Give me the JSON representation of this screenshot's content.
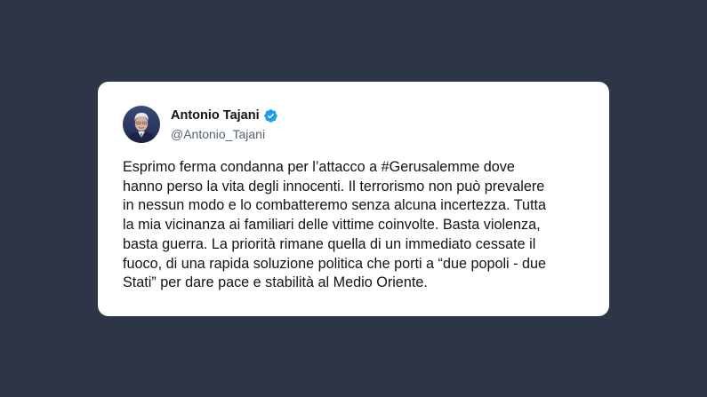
{
  "tweet": {
    "author": {
      "display_name": "Antonio Tajani",
      "handle": "@Antonio_Tajani",
      "verified": true,
      "avatar_icon": "profile-photo"
    },
    "text": "Esprimo ferma condanna per l’attacco a #Gerusalemme dove\nhanno perso la vita degli innocenti. Il terrorismo non può prevalere\nin nessun modo e lo combatteremo senza alcuna incertezza. Tutta\nla mia vicinanza ai familiari delle vittime coinvolte. Basta violenza,\nbasta guerra. La priorità rimane quella di un immediato cessate il\nfuoco, di una rapida soluzione politica che porti a “due popoli - due\nStati” per dare pace e stabilità al Medio Oriente."
  },
  "colors": {
    "background": "#2d3546",
    "card": "#ffffff",
    "text": "#0f1419",
    "secondary_text": "#536471",
    "verified_badge": "#1d9bf0"
  }
}
